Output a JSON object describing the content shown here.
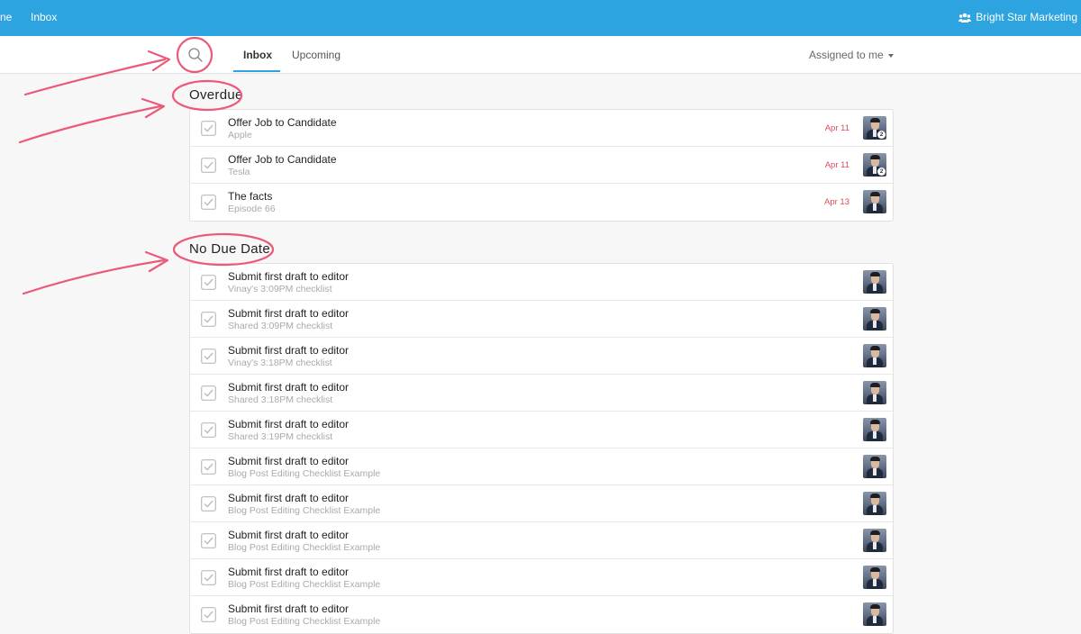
{
  "topbar": {
    "home_label": "ne",
    "inbox_label": "Inbox",
    "org_name": "Bright Star Marketing",
    "org_icon": "users-icon",
    "color": "#2da3e0"
  },
  "subbar": {
    "search_icon": "search-icon",
    "tabs": [
      {
        "label": "Inbox",
        "active": true
      },
      {
        "label": "Upcoming",
        "active": false
      }
    ],
    "filter_label": "Assigned to me"
  },
  "overdue": {
    "title": "Overdue",
    "items": [
      {
        "title": "Offer Job to Candidate",
        "subtitle": "Apple",
        "due": "Apr 11",
        "badge": "2"
      },
      {
        "title": "Offer Job to Candidate",
        "subtitle": "Tesla",
        "due": "Apr 11",
        "badge": "2"
      },
      {
        "title": "The facts",
        "subtitle": "Episode 66",
        "due": "Apr 13",
        "badge": ""
      }
    ]
  },
  "no_due_date": {
    "title": "No Due Date",
    "items": [
      {
        "title": "Submit first draft to editor",
        "subtitle": "Vinay's 3:09PM checklist"
      },
      {
        "title": "Submit first draft to editor",
        "subtitle": "Shared 3:09PM checklist"
      },
      {
        "title": "Submit first draft to editor",
        "subtitle": "Vinay's 3:18PM checklist"
      },
      {
        "title": "Submit first draft to editor",
        "subtitle": "Shared 3:18PM checklist"
      },
      {
        "title": "Submit first draft to editor",
        "subtitle": "Shared 3:19PM checklist"
      },
      {
        "title": "Submit first draft to editor",
        "subtitle": "Blog Post Editing Checklist Example"
      },
      {
        "title": "Submit first draft to editor",
        "subtitle": "Blog Post Editing Checklist Example"
      },
      {
        "title": "Submit first draft to editor",
        "subtitle": "Blog Post Editing Checklist Example"
      },
      {
        "title": "Submit first draft to editor",
        "subtitle": "Blog Post Editing Checklist Example"
      },
      {
        "title": "Submit first draft to editor",
        "subtitle": "Blog Post Editing Checklist Example"
      }
    ]
  },
  "colors": {
    "accent": "#2da3e0",
    "overdue": "#e14b59",
    "annotation": "#ec5a7a"
  }
}
